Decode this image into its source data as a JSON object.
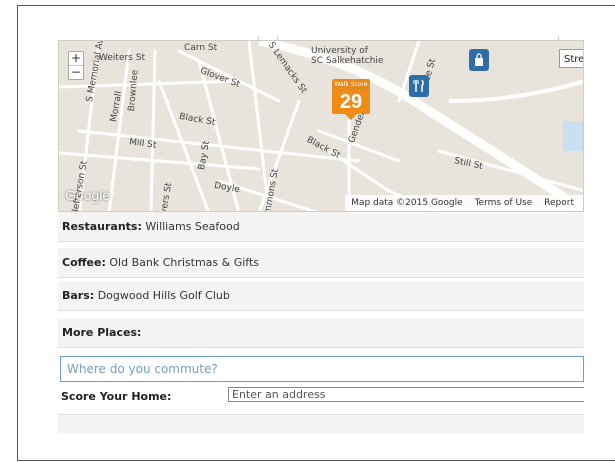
{
  "map": {
    "zoom_in": "+",
    "zoom_out": "−",
    "map_type_button": "Stre",
    "labels": [
      "Carn St",
      "Weiters St",
      "S Memorial Av",
      "Morrall",
      "Brownlee",
      "Glover St",
      "S Lemacks St",
      "University of",
      "SC Salkehatchie",
      "Black St",
      "Mill St",
      "Bay St",
      "Black St",
      "Gender",
      "Still St",
      "Doyle",
      "Jefferson St",
      "vers St",
      "mmons St",
      "ce St"
    ],
    "walk_score_label": "Walk Score",
    "walk_score_value": "29",
    "restaurant_icon": "fork-knife-icon",
    "shopping_icon": "shopping-bag-icon",
    "google_logo": "Google",
    "attribution": {
      "map_data": "Map data ©2015 Google",
      "terms": "Terms of Use",
      "report": "Report"
    }
  },
  "places": {
    "restaurants_label": "Restaurants:",
    "restaurants_value": "Williams Seafood",
    "coffee_label": "Coffee:",
    "coffee_value": "Old Bank Christmas & Gifts",
    "bars_label": "Bars:",
    "bars_value": "Dogwood Hills Golf Club",
    "more_label": "More Places:"
  },
  "commute": {
    "placeholder": "Where do you commute?"
  },
  "score_home": {
    "label": "Score Your Home:",
    "placeholder": "Enter an address"
  },
  "colors": {
    "walk_score_orange": "#f08c14",
    "poi_blue": "#2e6ea6",
    "commute_border": "#6aa0d6"
  }
}
